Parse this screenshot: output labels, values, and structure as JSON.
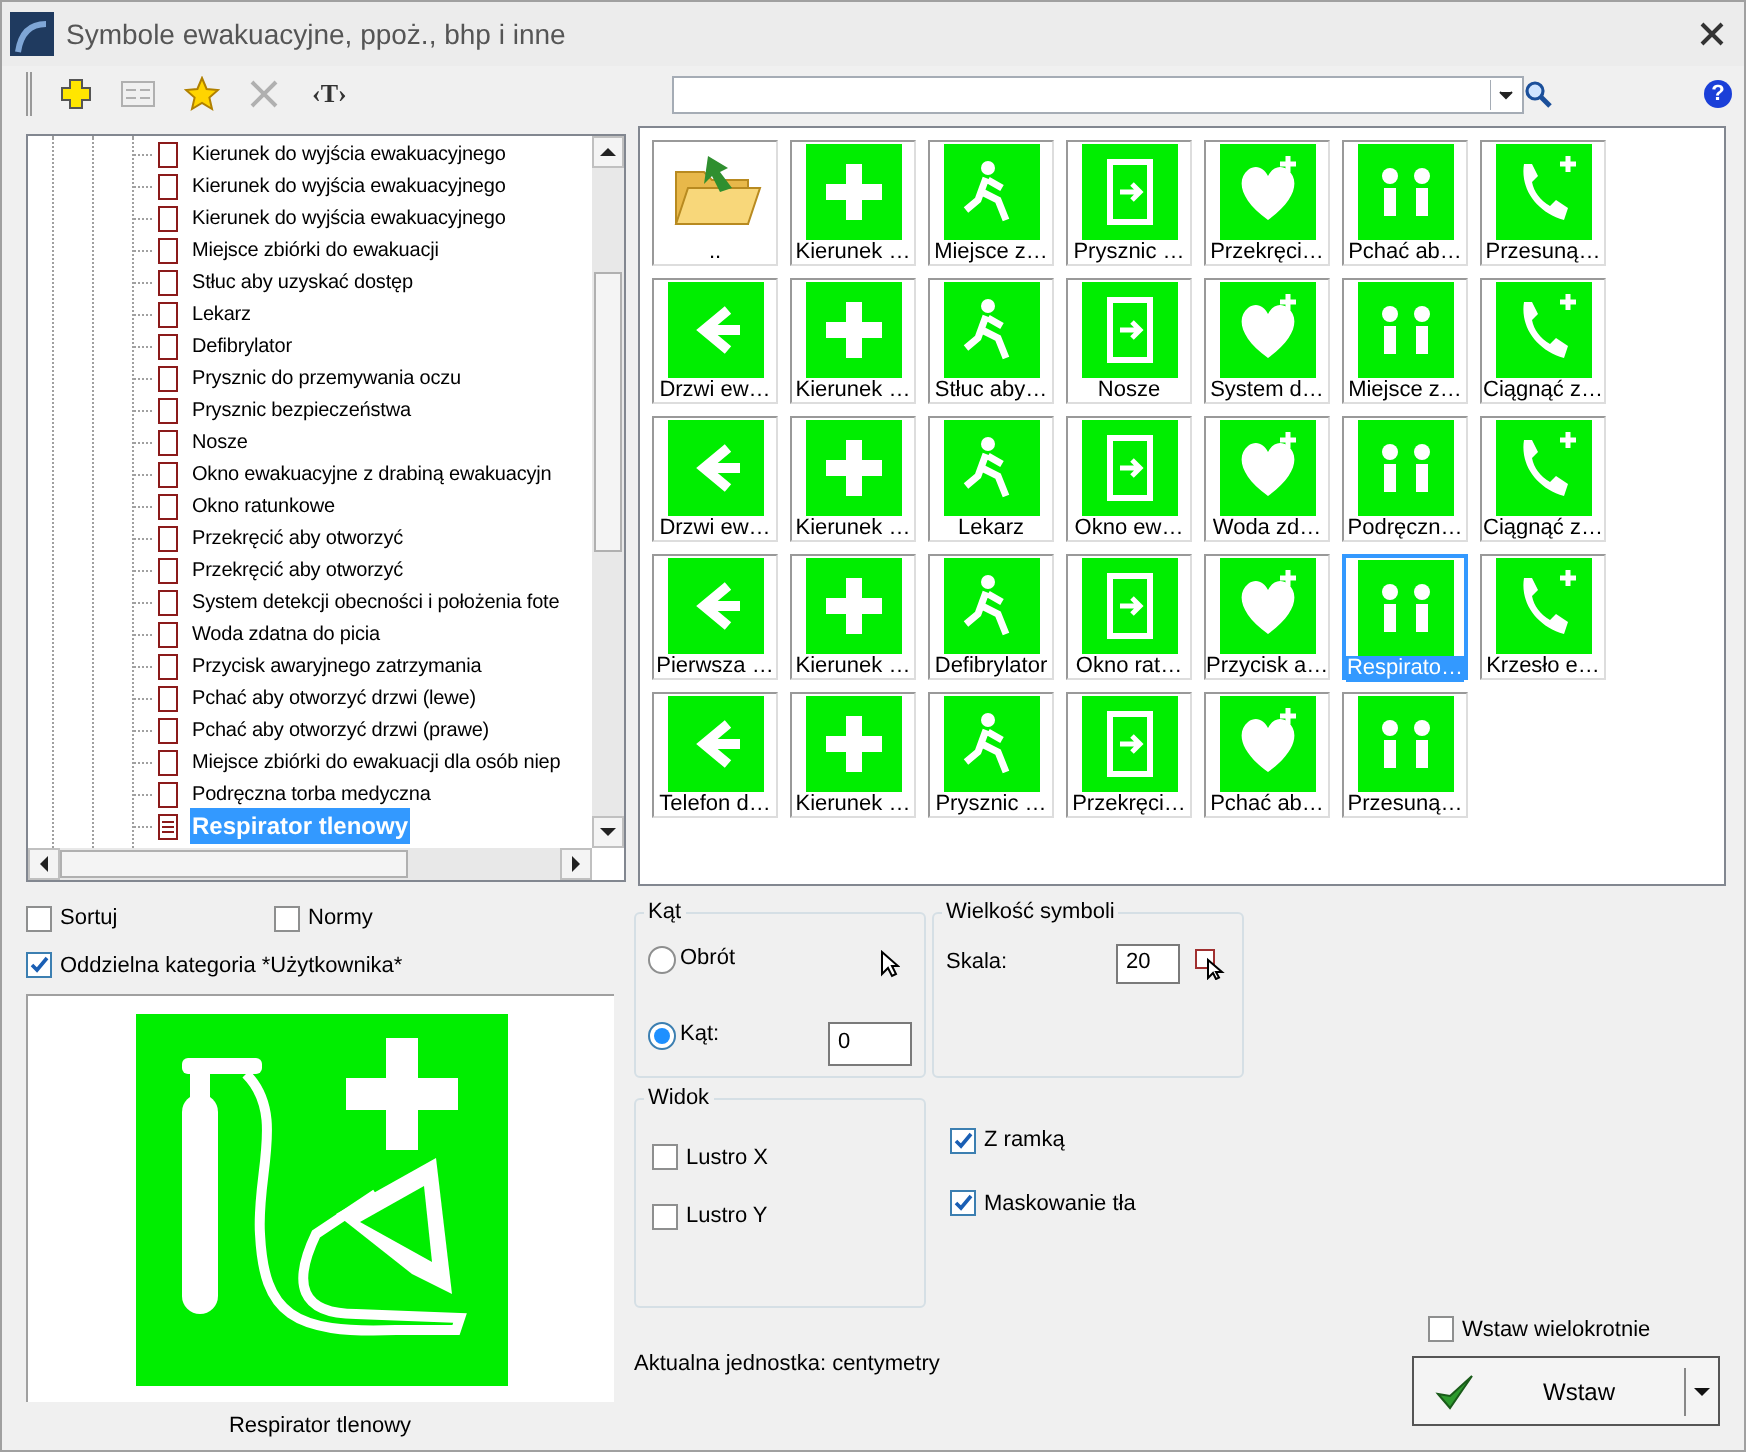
{
  "window": {
    "title": "Symbole ewakuacyjne, ppoż., bhp i inne"
  },
  "toolbar": [
    {
      "kind": "add",
      "disabled": false
    },
    {
      "kind": "list",
      "disabled": true
    },
    {
      "kind": "star",
      "disabled": false
    },
    {
      "kind": "delete",
      "disabled": true
    },
    {
      "kind": "text",
      "label": "‹T›",
      "disabled": false
    }
  ],
  "help": "?",
  "tree": [
    {
      "label": "Kierunek do wyjścia ewakuacyjnego",
      "selected": false
    },
    {
      "label": "Kierunek do wyjścia ewakuacyjnego",
      "selected": false
    },
    {
      "label": "Kierunek do wyjścia ewakuacyjnego",
      "selected": false
    },
    {
      "label": "Miejsce zbiórki do ewakuacji",
      "selected": false
    },
    {
      "label": "Stłuc aby uzyskać dostęp",
      "selected": false
    },
    {
      "label": "Lekarz",
      "selected": false
    },
    {
      "label": "Defibrylator",
      "selected": false
    },
    {
      "label": "Prysznic do przemywania oczu",
      "selected": false
    },
    {
      "label": "Prysznic bezpieczeństwa",
      "selected": false
    },
    {
      "label": "Nosze",
      "selected": false
    },
    {
      "label": "Okno ewakuacyjne z drabiną ewakuacyjn",
      "selected": false
    },
    {
      "label": "Okno ratunkowe",
      "selected": false
    },
    {
      "label": "Przekręcić aby otworzyć",
      "selected": false
    },
    {
      "label": "Przekręcić aby otworzyć",
      "selected": false
    },
    {
      "label": "System detekcji obecności i położenia fote",
      "selected": false
    },
    {
      "label": "Woda zdatna do picia",
      "selected": false
    },
    {
      "label": "Przycisk awaryjnego zatrzymania",
      "selected": false
    },
    {
      "label": "Pchać aby otworzyć drzwi (lewe)",
      "selected": false
    },
    {
      "label": "Pchać aby otworzyć drzwi (prawe)",
      "selected": false
    },
    {
      "label": "Miejsce zbiórki do ewakuacji dla osób niep",
      "selected": false
    },
    {
      "label": "Podręczna torba medyczna",
      "selected": false
    },
    {
      "label": "Respirator tlenowy",
      "selected": true
    }
  ],
  "symbols": [
    {
      "label": "..",
      "kind": "folder",
      "selected": false
    },
    {
      "label": "Kierunek …",
      "kind": "sign",
      "selected": false
    },
    {
      "label": "Miejsce z…",
      "kind": "sign",
      "selected": false
    },
    {
      "label": "Prysznic …",
      "kind": "sign",
      "selected": false
    },
    {
      "label": "Przekręci…",
      "kind": "sign",
      "selected": false
    },
    {
      "label": "Pchać ab…",
      "kind": "sign",
      "selected": false
    },
    {
      "label": "Przesuną…",
      "kind": "sign",
      "selected": false
    },
    {
      "label": "Drzwi ew…",
      "kind": "sign",
      "selected": false
    },
    {
      "label": "Kierunek …",
      "kind": "sign",
      "selected": false
    },
    {
      "label": "Stłuc aby…",
      "kind": "sign",
      "selected": false
    },
    {
      "label": "Nosze",
      "kind": "sign",
      "selected": false
    },
    {
      "label": "System d…",
      "kind": "sign",
      "selected": false
    },
    {
      "label": "Miejsce z…",
      "kind": "sign",
      "selected": false
    },
    {
      "label": "Ciągnąć z…",
      "kind": "sign",
      "selected": false
    },
    {
      "label": "Drzwi ew…",
      "kind": "sign",
      "selected": false
    },
    {
      "label": "Kierunek …",
      "kind": "sign",
      "selected": false
    },
    {
      "label": "Lekarz",
      "kind": "sign",
      "selected": false
    },
    {
      "label": "Okno ew…",
      "kind": "sign",
      "selected": false
    },
    {
      "label": "Woda zd…",
      "kind": "sign",
      "selected": false
    },
    {
      "label": "Podręczn…",
      "kind": "sign",
      "selected": false
    },
    {
      "label": "Ciągnąć z…",
      "kind": "sign",
      "selected": false
    },
    {
      "label": "Pierwsza …",
      "kind": "sign",
      "selected": false
    },
    {
      "label": "Kierunek …",
      "kind": "sign",
      "selected": false
    },
    {
      "label": "Defibrylator",
      "kind": "sign",
      "selected": false
    },
    {
      "label": "Okno rat…",
      "kind": "sign",
      "selected": false
    },
    {
      "label": "Przycisk a…",
      "kind": "sign",
      "selected": false
    },
    {
      "label": "Respirato…",
      "kind": "sign",
      "selected": true
    },
    {
      "label": "Krzesło e…",
      "kind": "sign",
      "selected": false
    },
    {
      "label": "Telefon d…",
      "kind": "sign",
      "selected": false
    },
    {
      "label": "Kierunek …",
      "kind": "sign",
      "selected": false
    },
    {
      "label": "Prysznic …",
      "kind": "sign",
      "selected": false
    },
    {
      "label": "Przekręci…",
      "kind": "sign",
      "selected": false
    },
    {
      "label": "Pchać ab…",
      "kind": "sign",
      "selected": false
    },
    {
      "label": "Przesuną…",
      "kind": "sign",
      "selected": false
    }
  ],
  "filters": [
    {
      "label": "Sortuj",
      "checked": false
    },
    {
      "label": "Normy",
      "checked": false
    },
    {
      "label": "Oddzielna kategoria *Użytkownika*",
      "checked": true
    }
  ],
  "preview": {
    "caption": "Respirator tlenowy"
  },
  "angle": {
    "title": "Kąt",
    "options": [
      {
        "label": "Obrót",
        "selected": false
      },
      {
        "label": "Kąt:",
        "selected": true
      }
    ],
    "value": "0"
  },
  "size": {
    "title": "Wielkość symboli",
    "label": "Skala:",
    "value": "20"
  },
  "view": {
    "title": "Widok",
    "options": [
      {
        "label": "Lustro X",
        "checked": false
      },
      {
        "label": "Lustro Y",
        "checked": false
      }
    ]
  },
  "frame_options": [
    {
      "label": "Z ramką",
      "checked": true
    },
    {
      "label": "Maskowanie tła",
      "checked": true
    }
  ],
  "unit_text": "Aktualna jednostka: centymetry",
  "insert_multiple": {
    "label": "Wstaw wielokrotnie",
    "checked": false
  },
  "insert_button": {
    "label": "Wstaw"
  }
}
